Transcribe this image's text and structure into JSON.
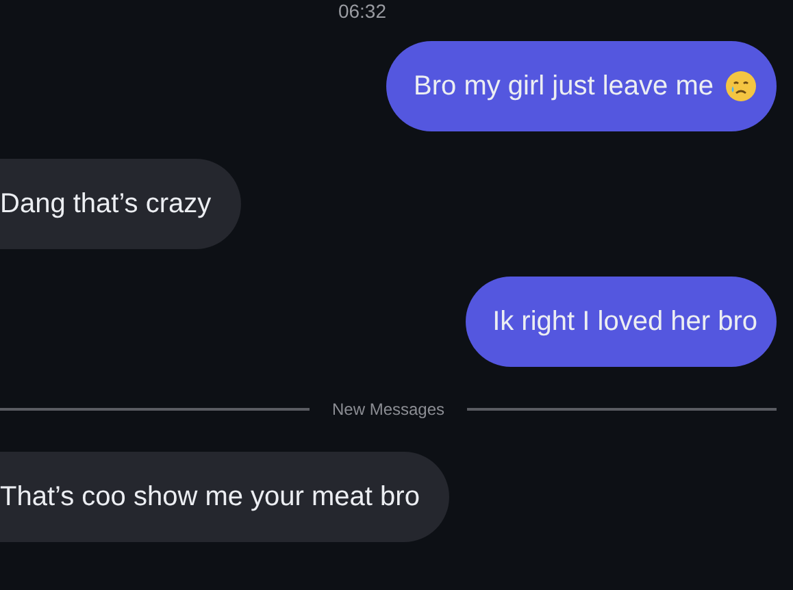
{
  "timestamp": "06:32",
  "messages_before": [
    {
      "kind": "sent",
      "text": "Bro my girl just leave me",
      "emoji": true
    },
    {
      "kind": "received",
      "text": "Dang that’s crazy"
    },
    {
      "kind": "sent",
      "text": "Ik right I loved her bro"
    }
  ],
  "divider": {
    "label": "New Messages"
  },
  "messages_after": [
    {
      "kind": "received",
      "text": "That’s coo show me your meat bro"
    }
  ]
}
